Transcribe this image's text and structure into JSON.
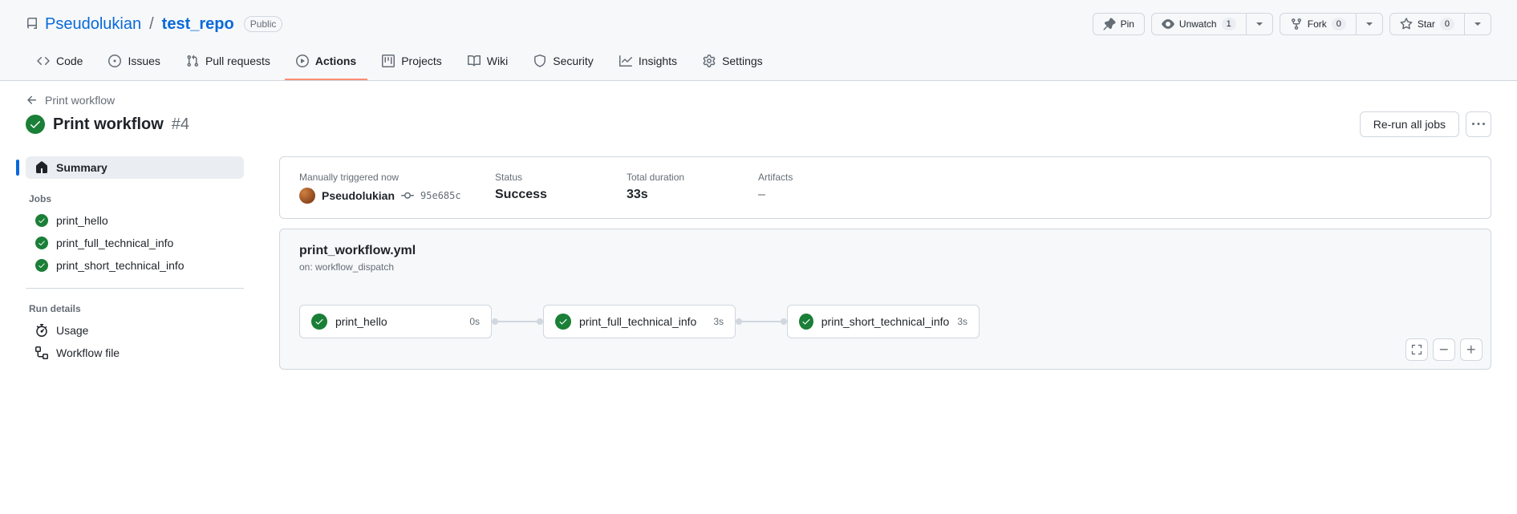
{
  "repo": {
    "owner": "Pseudolukian",
    "name": "test_repo",
    "visibility": "Public"
  },
  "repo_actions": {
    "pin": "Pin",
    "unwatch": "Unwatch",
    "unwatch_count": "1",
    "fork": "Fork",
    "fork_count": "0",
    "star": "Star",
    "star_count": "0"
  },
  "repo_nav": [
    {
      "label": "Code",
      "icon": "code-icon"
    },
    {
      "label": "Issues",
      "icon": "issues-icon"
    },
    {
      "label": "Pull requests",
      "icon": "pr-icon"
    },
    {
      "label": "Actions",
      "icon": "actions-icon",
      "selected": true
    },
    {
      "label": "Projects",
      "icon": "projects-icon"
    },
    {
      "label": "Wiki",
      "icon": "wiki-icon"
    },
    {
      "label": "Security",
      "icon": "security-icon"
    },
    {
      "label": "Insights",
      "icon": "insights-icon"
    },
    {
      "label": "Settings",
      "icon": "settings-icon"
    }
  ],
  "back_link": "Print workflow",
  "run": {
    "title": "Print workflow",
    "number": "#4",
    "rerun_label": "Re-run all jobs"
  },
  "sidebar": {
    "summary_label": "Summary",
    "jobs_heading": "Jobs",
    "jobs": [
      {
        "name": "print_hello"
      },
      {
        "name": "print_full_technical_info"
      },
      {
        "name": "print_short_technical_info"
      }
    ],
    "details_heading": "Run details",
    "details": [
      {
        "label": "Usage",
        "name": "usage-link"
      },
      {
        "label": "Workflow file",
        "name": "workflow-file-link"
      }
    ]
  },
  "summary": {
    "trigger_label": "Manually triggered now",
    "actor": "Pseudolukian",
    "sha": "95e685c",
    "status_label": "Status",
    "status_value": "Success",
    "duration_label": "Total duration",
    "duration_value": "33s",
    "artifacts_label": "Artifacts",
    "artifacts_value": "–"
  },
  "graph": {
    "file": "print_workflow.yml",
    "trigger": "on: workflow_dispatch",
    "jobs": [
      {
        "name": "print_hello",
        "duration": "0s"
      },
      {
        "name": "print_full_technical_info",
        "duration": "3s"
      },
      {
        "name": "print_short_technical_info",
        "duration": "3s"
      }
    ]
  }
}
